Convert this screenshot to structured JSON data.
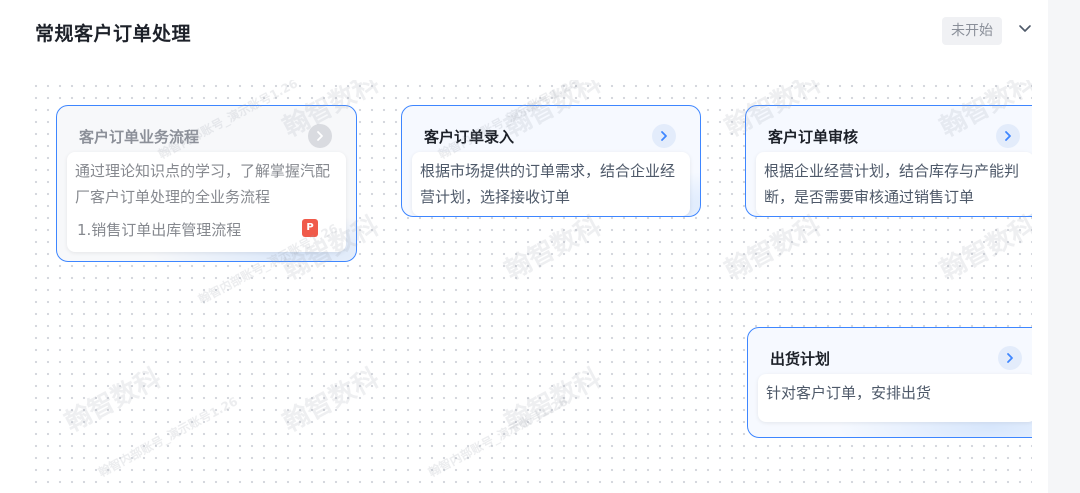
{
  "header": {
    "title": "常规客户订单处理",
    "status": "未开始"
  },
  "nodes": [
    {
      "title": "客户订单业务流程",
      "description": "通过理论知识点的学习，了解掌握汽配厂客户订单处理的全业务流程",
      "attachment": "1.销售订单出库管理流程",
      "state": "disabled"
    },
    {
      "title": "客户订单录入",
      "description": "根据市场提供的订单需求，结合企业经营计划，选择接收订单",
      "state": "active"
    },
    {
      "title": "客户订单审核",
      "description": "根据企业经营计划，结合库存与产能判断，是否需要审核通过销售订单",
      "state": "active"
    },
    {
      "title": "出货计划",
      "description": "针对客户订单，安排出货",
      "state": "active"
    }
  ],
  "watermark": {
    "brand": "翰智数科",
    "tag": "翰智内部账号_演示账号1.26"
  },
  "colors": {
    "accent": "#3e86ff",
    "card_bg": "#f6f9ff",
    "status_bg": "#f0f1f4"
  },
  "icons": [
    "chevron-down-icon",
    "chevron-right-icon",
    "ppt-file-icon"
  ]
}
